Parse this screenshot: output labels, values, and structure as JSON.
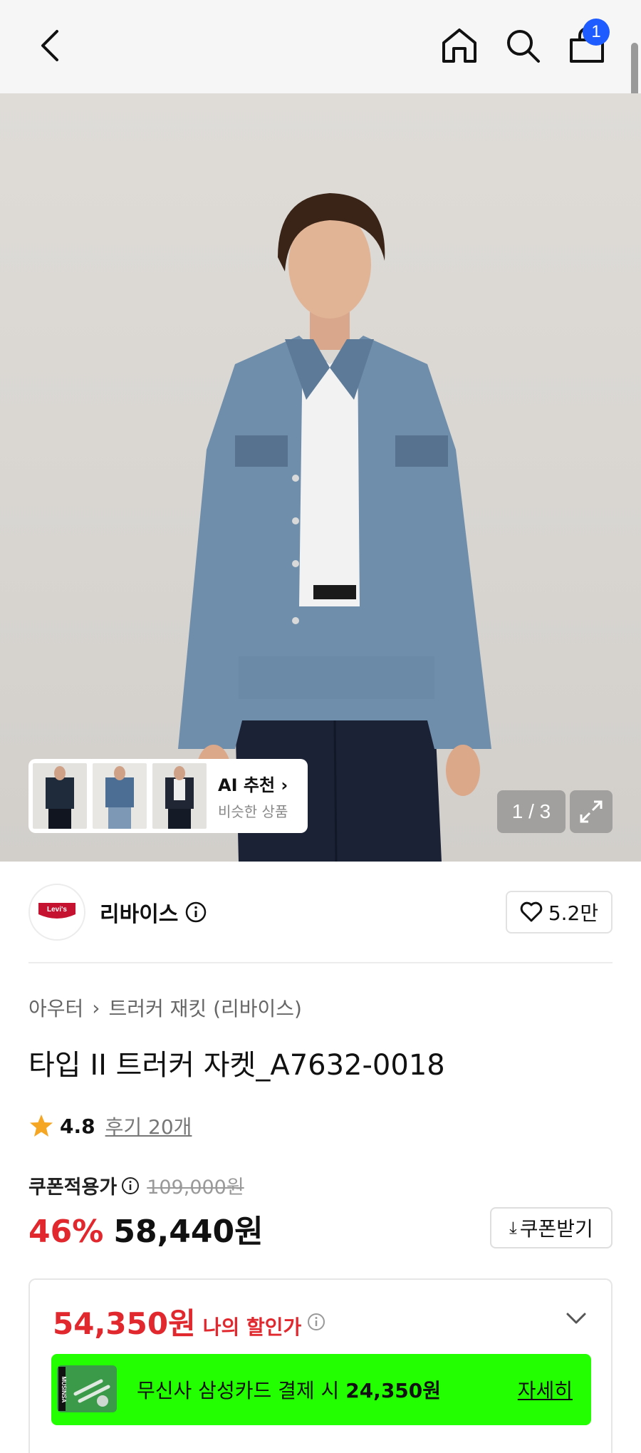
{
  "header": {
    "cart_count": "1"
  },
  "hero": {
    "pager": "1 / 3",
    "ai_title": "AI 추천",
    "ai_subtitle": "비슷한 상품"
  },
  "brand": {
    "logo_text": "Levi's",
    "name": "리바이스",
    "likes": "5.2만"
  },
  "product": {
    "breadcrumb": [
      "아우터",
      "트러커 재킷 (리바이스)"
    ],
    "title": "타입 II 트러커 자켓_A7632-0018",
    "rating": "4.8",
    "reviews": "후기 20개",
    "coupon_label": "쿠폰적용가",
    "original_price": "109,000원",
    "discount": "46%",
    "price": "58,440원",
    "coupon_button": "쿠폰받기"
  },
  "my_price": {
    "value": "54,350원",
    "label": "나의 할인가"
  },
  "card_promo": {
    "text": "무신사 삼성카드 결제 시",
    "amount": "24,350원",
    "more": "자세히",
    "card_logo_text": "MUSINSA"
  },
  "colors": {
    "accent_red": "#e0282e",
    "badge_blue": "#1f5cff",
    "promo_green": "#23ff00",
    "star": "#f5a623"
  }
}
